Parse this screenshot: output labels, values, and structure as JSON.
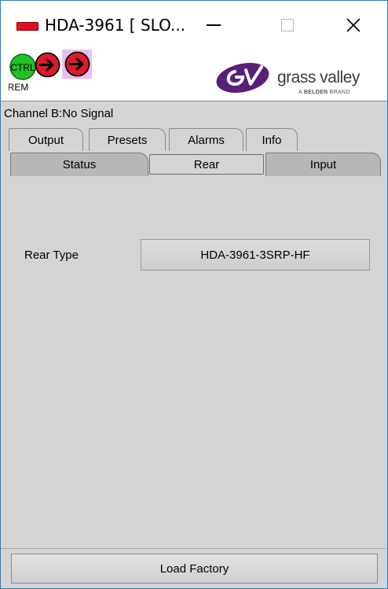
{
  "window": {
    "title": "HDA-3961 [ SLO...",
    "minimize_glyph": "—",
    "close_glyph": "✕"
  },
  "header": {
    "ctrl_label": "CTRL",
    "rem_label": "REM",
    "logo_text": "grass valley",
    "logo_sub_a": "A ",
    "logo_sub_brand": "BELDEN",
    "logo_sub_b": " BRAND"
  },
  "status_line": "Channel B:No Signal",
  "tabs_row1": [
    {
      "label": "Output"
    },
    {
      "label": "Presets"
    },
    {
      "label": "Alarms"
    },
    {
      "label": "Info"
    }
  ],
  "tabs_row2": [
    {
      "label": "Status"
    },
    {
      "label": "Rear",
      "active": true
    },
    {
      "label": "Input"
    }
  ],
  "rear": {
    "label": "Rear Type",
    "value": "HDA-3961-3SRP-HF"
  },
  "footer": {
    "load_factory_label": "Load Factory"
  },
  "colors": {
    "window_border": "#1883d7",
    "panel_bg": "#d4d4d4",
    "ctrl_green": "#23c02a",
    "arrow_red": "#e01a2a",
    "logo_purple": "#5a1d78"
  }
}
